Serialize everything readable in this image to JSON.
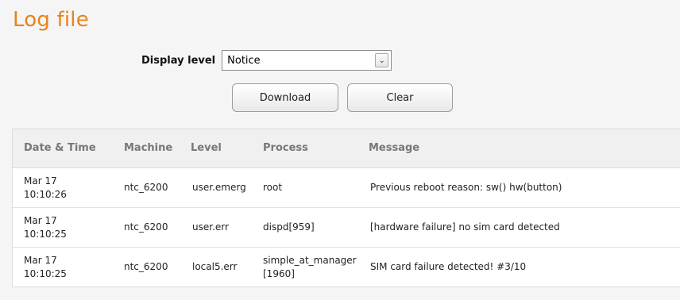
{
  "page": {
    "title": "Log file"
  },
  "controls": {
    "display_level_label": "Display level",
    "display_level_value": "Notice",
    "download_label": "Download",
    "clear_label": "Clear"
  },
  "table": {
    "headers": {
      "datetime": "Date & Time",
      "machine": "Machine",
      "level": "Level",
      "process": "Process",
      "message": "Message"
    },
    "rows": [
      {
        "datetime": "Mar 17 10:10:26",
        "machine": "ntc_6200",
        "level": "user.emerg",
        "process": "root",
        "message": "Previous reboot reason: sw() hw(button)"
      },
      {
        "datetime": "Mar 17 10:10:25",
        "machine": "ntc_6200",
        "level": "user.err",
        "process": "dispd[959]",
        "message": "[hardware failure] no sim card detected"
      },
      {
        "datetime": "Mar 17 10:10:25",
        "machine": "ntc_6200",
        "level": "local5.err",
        "process": "simple_at_manager[1960]",
        "message": "SIM card failure detected! #3/10"
      }
    ]
  },
  "colors": {
    "title": "#e8821c",
    "header_text": "#777777"
  },
  "icons": {
    "select_arrow": "chevron-down-icon"
  }
}
